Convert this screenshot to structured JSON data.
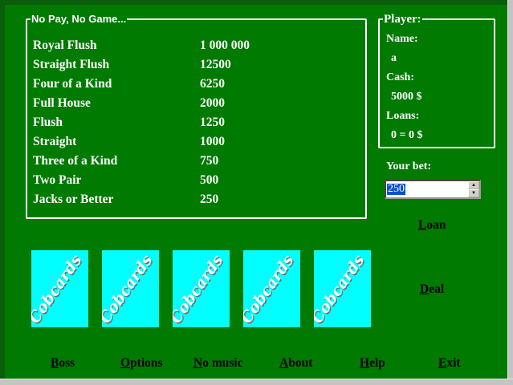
{
  "paytable": {
    "title": "No Pay, No Game...",
    "rows": [
      {
        "hand": "Royal Flush",
        "pays": "1 000 000"
      },
      {
        "hand": "Straight Flush",
        "pays": "12500"
      },
      {
        "hand": "Four of a Kind",
        "pays": "6250"
      },
      {
        "hand": "Full House",
        "pays": "2000"
      },
      {
        "hand": "Flush",
        "pays": "1250"
      },
      {
        "hand": "Straight",
        "pays": "1000"
      },
      {
        "hand": "Three of a Kind",
        "pays": "750"
      },
      {
        "hand": "Two Pair",
        "pays": "500"
      },
      {
        "hand": "Jacks or Better",
        "pays": "250"
      }
    ]
  },
  "player": {
    "title": "Player:",
    "name_label": "Name:",
    "name_value": "a",
    "cash_label": "Cash:",
    "cash_value": "5000 $",
    "loans_label": "Loans:",
    "loans_value": "0 = 0 $"
  },
  "bet": {
    "label": "Your bet:",
    "value": "250"
  },
  "actions": {
    "loan": {
      "first": "L",
      "rest": "oan"
    },
    "deal": {
      "first": "D",
      "rest": "eal"
    }
  },
  "cards": {
    "back_text": "Cobcards",
    "count": 5,
    "colors": {
      "face": "#00ffff",
      "text": "#ffffff",
      "text_shadow": "#6e6e6e"
    }
  },
  "menu": [
    {
      "first": "B",
      "rest": "oss"
    },
    {
      "first": "O",
      "rest": "ptions"
    },
    {
      "first": "N",
      "rest": "o music"
    },
    {
      "first": "A",
      "rest": "bout"
    },
    {
      "first": "H",
      "rest": "elp"
    },
    {
      "first": "E",
      "rest": "xit"
    }
  ],
  "colors": {
    "table": "#007a00",
    "frame": "#c4c4c4",
    "selection": "#0a52ce"
  }
}
